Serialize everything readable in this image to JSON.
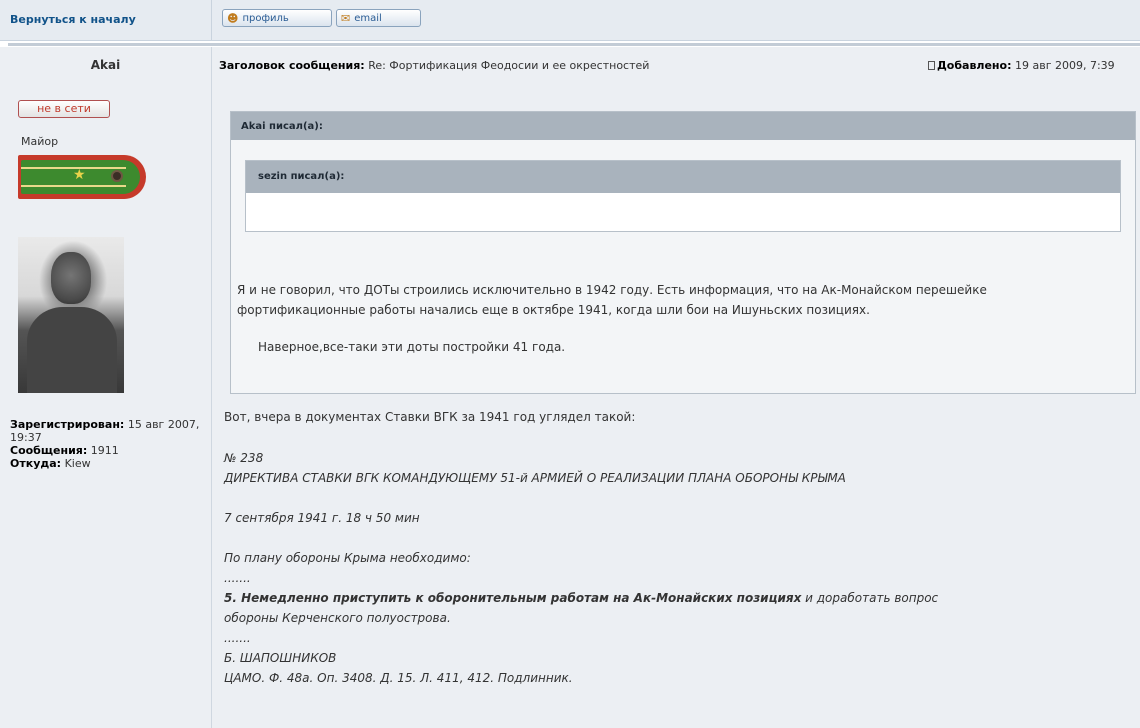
{
  "nav": {
    "back_label": "Вернуться к началу",
    "profile_label": "профиль",
    "email_label": "email"
  },
  "poster": {
    "username": "Akai",
    "status": "не в сети",
    "rank": "Майор",
    "registered_label": "Зарегистрирован:",
    "registered_value": "15 авг 2007, 19:37",
    "posts_label": "Сообщения:",
    "posts_value": "1911",
    "from_label": "Откуда:",
    "from_value": "Kiew"
  },
  "post": {
    "subject_label": "Заголовок сообщения:",
    "subject_value": "Re: Фортификация Феодосии и ее окрестностей",
    "date_label": "Добавлено:",
    "date_value": "19 авг 2009, 7:39"
  },
  "quote": {
    "author": "Akai писал(а):",
    "nested_author": "sezin писал(а):",
    "nested_text": "Наверное,все-таки эти доты постройки 41 года.",
    "text_line1": "Я и не говорил, что ДОТы строились исключительно в 1942 году. Есть информация, что на Ак-Монайском перешейке",
    "text_line2": "фортификационные работы начались еще в октябре 1941, когда шли бои на Ишуньских позициях."
  },
  "body": {
    "intro": "Вот, вчера в документах Ставки ВГК за 1941 год углядел такой:",
    "doc_number": "№ 238",
    "doc_title": "ДИРЕКТИВА СТАВКИ ВГК КОМАНДУЮЩЕМУ 51-й АРМИЕЙ О РЕАЛИЗАЦИИ ПЛАНА ОБОРОНЫ КРЫМА",
    "doc_date": "7 сентября 1941 г. 18 ч 50 мин",
    "plan_intro": "По плану обороны Крыма необходимо:",
    "dots1": ".......",
    "item5_bold": "5. Немедленно приступить к оборонительным работам на Ак-Монайских позициях",
    "item5_rest": " и доработать вопрос",
    "item5_line2": "обороны Керченского полуострова.",
    "dots2": ".......",
    "signature": "Б. ШАПОШНИКОВ",
    "source": "ЦАМО. Ф. 48а. Оп. 3408. Д. 15. Л. 411, 412. Подлинник."
  },
  "colors": {
    "link": "#105289",
    "panel_bg": "#eceff3",
    "quote_header": "#a9b3bd",
    "offline_red": "#c0392b"
  }
}
